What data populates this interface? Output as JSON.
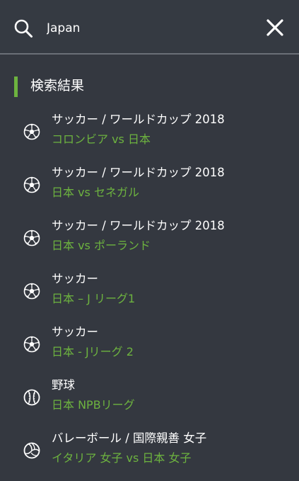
{
  "search": {
    "value": "Japan",
    "icon": "search-icon",
    "close_icon": "close-icon"
  },
  "results_header": {
    "title": "検索結果",
    "accent_color": "#6db33f"
  },
  "results": [
    {
      "category": "サッカー / ワールドカップ 2018",
      "match": "コロンビア vs 日本",
      "icon": "soccer-ball-icon"
    },
    {
      "category": "サッカー / ワールドカップ 2018",
      "match": "日本 vs セネガル",
      "icon": "soccer-ball-icon"
    },
    {
      "category": "サッカー / ワールドカップ 2018",
      "match": "日本 vs ポーランド",
      "icon": "soccer-ball-icon"
    },
    {
      "category": "サッカー",
      "match": "日本 – J リーグ1",
      "icon": "soccer-ball-icon"
    },
    {
      "category": "サッカー",
      "match": "日本 - Jリーグ 2",
      "icon": "soccer-ball-icon"
    },
    {
      "category": "野球",
      "match": "日本 NPBリーグ",
      "icon": "baseball-icon"
    },
    {
      "category": "バレーボール / 国際親善 女子",
      "match": "イタリア 女子 vs 日本 女子",
      "icon": "volleyball-icon"
    }
  ],
  "colors": {
    "background": "#343840",
    "accent_green": "#6db33f",
    "text": "#ffffff"
  }
}
